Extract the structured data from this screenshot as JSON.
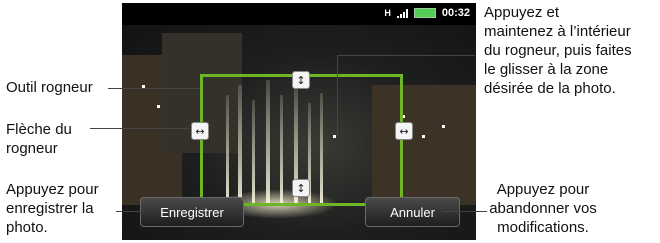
{
  "status": {
    "time": "00:32",
    "network_label": "H"
  },
  "buttons": {
    "save": "Enregistrer",
    "cancel": "Annuler"
  },
  "annotations": {
    "crop_tool": [
      "Outil rogneur"
    ],
    "crop_arrow": [
      "Flèche du",
      "rogneur"
    ],
    "save_hint": [
      "Appuyez pour",
      "enregistrer la",
      "photo."
    ],
    "drag_hint": [
      "Appuyez et",
      "maintenez à l’intérieur",
      "du rogneur, puis faites",
      "le glisser à la zone",
      "désirée de la photo."
    ],
    "cancel_hint": [
      "Appuyez pour",
      "abandonner vos",
      "modifications."
    ]
  },
  "icons": {
    "up_down": "↕",
    "left_right": "↔"
  },
  "colors": {
    "crop_border": "#6fb626"
  }
}
